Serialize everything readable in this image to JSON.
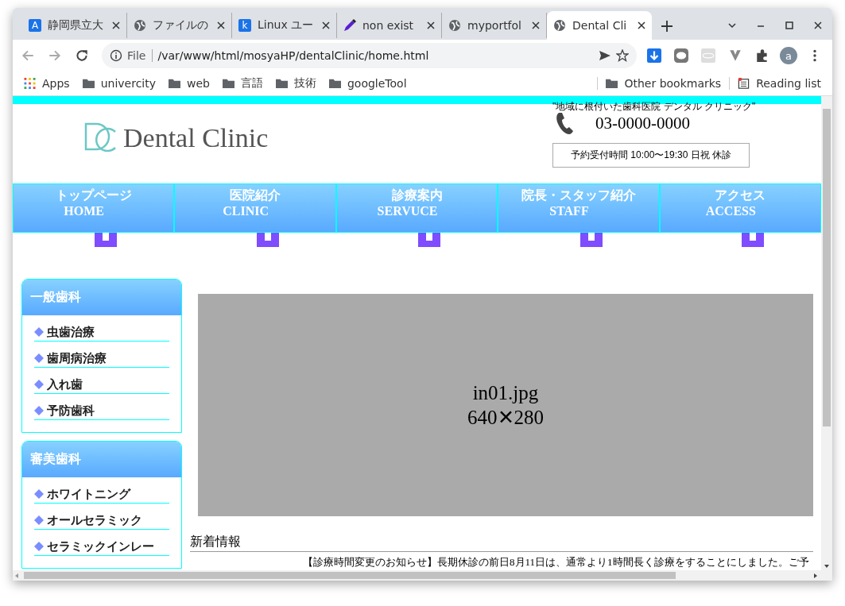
{
  "tabs": [
    {
      "kind": "letter",
      "icon_text": "A",
      "title": "静岡県立大",
      "selected": false
    },
    {
      "kind": "globe",
      "title": "ファイルの",
      "selected": false
    },
    {
      "kind": "letter",
      "icon_text": "k",
      "title": "Linux ユー",
      "selected": false
    },
    {
      "kind": "pen",
      "title": "non exist",
      "selected": false
    },
    {
      "kind": "globe",
      "title": "myportfol",
      "selected": false
    },
    {
      "kind": "globe",
      "title": "Dental Cli",
      "selected": true
    }
  ],
  "toolbar": {
    "scheme": "File",
    "url": "/var/www/html/mosyaHP/dentalClinic/home.html",
    "avatar": "a"
  },
  "bookmarks": [
    {
      "kind": "apps",
      "label": "Apps"
    },
    {
      "kind": "folder",
      "label": "univercity"
    },
    {
      "kind": "folder",
      "label": "web"
    },
    {
      "kind": "folder",
      "label": "言語"
    },
    {
      "kind": "folder",
      "label": "技術"
    },
    {
      "kind": "folder",
      "label": "googleTool"
    }
  ],
  "other_bookmarks": "Other bookmarks",
  "reading_list": "Reading list",
  "header": {
    "logo": "Dental Clinic",
    "tagline": "\"地域に根付いた歯科医院 デンタル クリニック\"",
    "phone": "03-0000-0000",
    "hours": "予約受付時間 10:00〜19:30 日祝 休診"
  },
  "nav": [
    {
      "ja": "トップページ",
      "en": "HOME"
    },
    {
      "ja": "医院紹介",
      "en": "CLINIC"
    },
    {
      "ja": "診療案内",
      "en": "SERVUCE"
    },
    {
      "ja": "院長・スタッフ紹介",
      "en": "STAFF"
    },
    {
      "ja": "アクセス",
      "en": "ACCESS"
    }
  ],
  "sidebar": [
    {
      "title": "一般歯科",
      "items": [
        "虫歯治療",
        "歯周病治療",
        "入れ歯",
        "予防歯科"
      ]
    },
    {
      "title": "審美歯科",
      "items": [
        "ホワイトニング",
        "オールセラミック",
        "セラミックインレー"
      ]
    }
  ],
  "placeholder_image": {
    "name": "in01.jpg",
    "size": "640✕280"
  },
  "news": {
    "title": "新着情報",
    "items": [
      "【診療時間変更のお知らせ】長期休診の前日8月11日は、通常より1時間長く診療をすることにしました。ご予"
    ]
  }
}
